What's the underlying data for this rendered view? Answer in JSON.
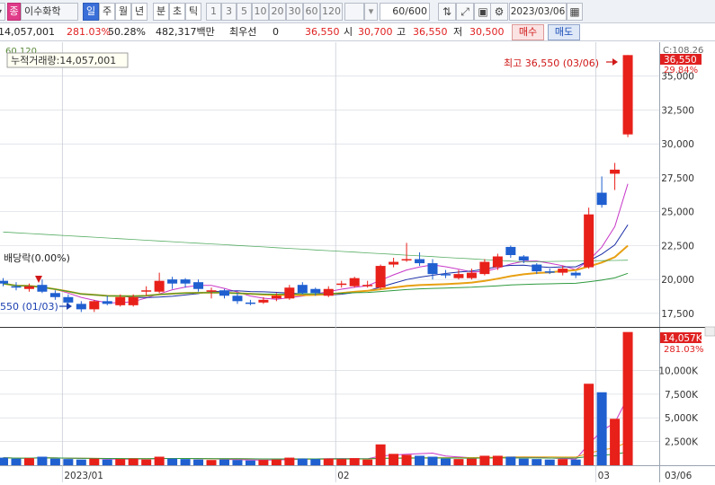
{
  "toolbar": {
    "stock_type_badge": "종",
    "stock_name": "이수화학",
    "period_tabs": [
      "일",
      "주",
      "월",
      "년",
      "분",
      "초",
      "틱"
    ],
    "selected_period": "일",
    "interval_buttons": [
      "1",
      "3",
      "5",
      "10",
      "20",
      "30",
      "60",
      "120"
    ],
    "count_value": "60",
    "count_total": "/600",
    "date_value": "2023/03/06"
  },
  "quote": {
    "volume": "14,057,001",
    "volume_ratio": "281.03%",
    "turnover_rate": "50.28%",
    "trade_value": "482,317백만",
    "priority_label": "최우선",
    "priority_value": "0",
    "current_price": "36,550",
    "open_label": "시",
    "open": "30,700",
    "high_label": "고",
    "high": "36,550",
    "low_label": "저",
    "low": "30,500",
    "buy_button": "매수",
    "sell_button": "매도"
  },
  "price_panel": {
    "ma_header": "60 120",
    "cum_volume_tooltip": "누적거래량:14,057,001",
    "high_annotation": "최고 36,550 (03/06)",
    "low_annotation": "550 (01/03)",
    "dividend_label": "배당락(0.00%)",
    "c_value": "C:108.26",
    "current_label": "36,550",
    "change_label": "29.84%"
  },
  "volume_panel": {
    "current_label": "14,057K",
    "ratio_label": "281.03%"
  },
  "chart_data": {
    "type": "candlestick",
    "price_axis": {
      "ticks": [
        17500,
        20000,
        22500,
        25000,
        27500,
        30000,
        32500,
        35000
      ],
      "ylim": [
        16500,
        37500
      ]
    },
    "volume_axis": {
      "ticks": [
        "2,500K",
        "5,000K",
        "7,500K",
        "10,000K"
      ],
      "tick_values": [
        2500,
        5000,
        7500,
        10000
      ],
      "ylim": [
        0,
        14500
      ]
    },
    "x_labels": [
      "2023/01",
      "02",
      "03",
      "03/06"
    ],
    "candles": [
      {
        "o": 19900,
        "c": 19700,
        "h": 20100,
        "l": 19500,
        "v": 800
      },
      {
        "o": 19500,
        "c": 19400,
        "h": 19800,
        "l": 19200,
        "v": 700
      },
      {
        "o": 19300,
        "c": 19500,
        "h": 19700,
        "l": 19100,
        "v": 750
      },
      {
        "o": 19600,
        "c": 19100,
        "h": 20000,
        "l": 19000,
        "v": 900
      },
      {
        "o": 19000,
        "c": 18700,
        "h": 19200,
        "l": 18500,
        "v": 700
      },
      {
        "o": 18700,
        "c": 18300,
        "h": 18900,
        "l": 18100,
        "v": 650
      },
      {
        "o": 18200,
        "c": 17800,
        "h": 18400,
        "l": 17600,
        "v": 600
      },
      {
        "o": 17800,
        "c": 18400,
        "h": 18500,
        "l": 17600,
        "v": 700
      },
      {
        "o": 18400,
        "c": 18200,
        "h": 18800,
        "l": 18100,
        "v": 600
      },
      {
        "o": 18100,
        "c": 18700,
        "h": 18900,
        "l": 18000,
        "v": 650
      },
      {
        "o": 18100,
        "c": 18700,
        "h": 18900,
        "l": 18000,
        "v": 700
      },
      {
        "o": 19100,
        "c": 19200,
        "h": 19500,
        "l": 18800,
        "v": 600
      },
      {
        "o": 19100,
        "c": 19900,
        "h": 20500,
        "l": 19000,
        "v": 900
      },
      {
        "o": 20000,
        "c": 19700,
        "h": 20200,
        "l": 19300,
        "v": 700
      },
      {
        "o": 20000,
        "c": 19700,
        "h": 20100,
        "l": 19400,
        "v": 650
      },
      {
        "o": 19800,
        "c": 19300,
        "h": 20000,
        "l": 19100,
        "v": 600
      },
      {
        "o": 19100,
        "c": 19200,
        "h": 19400,
        "l": 18600,
        "v": 550
      },
      {
        "o": 19200,
        "c": 18800,
        "h": 19300,
        "l": 18600,
        "v": 600
      },
      {
        "o": 18800,
        "c": 18400,
        "h": 19000,
        "l": 18200,
        "v": 550
      },
      {
        "o": 18300,
        "c": 18200,
        "h": 18500,
        "l": 18100,
        "v": 500
      },
      {
        "o": 18300,
        "c": 18500,
        "h": 18700,
        "l": 18200,
        "v": 550
      },
      {
        "o": 18600,
        "c": 18800,
        "h": 19000,
        "l": 18400,
        "v": 600
      },
      {
        "o": 18600,
        "c": 19400,
        "h": 19600,
        "l": 18500,
        "v": 800
      },
      {
        "o": 19600,
        "c": 19000,
        "h": 19800,
        "l": 18900,
        "v": 700
      },
      {
        "o": 19300,
        "c": 19000,
        "h": 19400,
        "l": 18800,
        "v": 650
      },
      {
        "o": 18800,
        "c": 19300,
        "h": 19500,
        "l": 18700,
        "v": 700
      },
      {
        "o": 19600,
        "c": 19700,
        "h": 19900,
        "l": 19400,
        "v": 650
      },
      {
        "o": 19500,
        "c": 20100,
        "h": 20200,
        "l": 19400,
        "v": 750
      },
      {
        "o": 19600,
        "c": 19600,
        "h": 19900,
        "l": 19400,
        "v": 600
      },
      {
        "o": 19400,
        "c": 21000,
        "h": 21100,
        "l": 19300,
        "v": 2200
      },
      {
        "o": 21100,
        "c": 21300,
        "h": 21600,
        "l": 20900,
        "v": 1200
      },
      {
        "o": 21500,
        "c": 21500,
        "h": 22700,
        "l": 21300,
        "v": 1100
      },
      {
        "o": 21500,
        "c": 21200,
        "h": 22000,
        "l": 21000,
        "v": 1000
      },
      {
        "o": 21200,
        "c": 20400,
        "h": 21500,
        "l": 20000,
        "v": 900
      },
      {
        "o": 20400,
        "c": 20300,
        "h": 20700,
        "l": 20100,
        "v": 700
      },
      {
        "o": 20100,
        "c": 20400,
        "h": 20700,
        "l": 20000,
        "v": 650
      },
      {
        "o": 20100,
        "c": 20500,
        "h": 20800,
        "l": 20000,
        "v": 700
      },
      {
        "o": 20400,
        "c": 21300,
        "h": 21500,
        "l": 20300,
        "v": 1000
      },
      {
        "o": 20900,
        "c": 21700,
        "h": 21900,
        "l": 20700,
        "v": 1000
      },
      {
        "o": 22400,
        "c": 21800,
        "h": 22500,
        "l": 21600,
        "v": 900
      },
      {
        "o": 21700,
        "c": 21400,
        "h": 21800,
        "l": 21200,
        "v": 700
      },
      {
        "o": 21100,
        "c": 20600,
        "h": 21200,
        "l": 20400,
        "v": 650
      },
      {
        "o": 20600,
        "c": 20500,
        "h": 20800,
        "l": 20400,
        "v": 600
      },
      {
        "o": 20500,
        "c": 20800,
        "h": 21000,
        "l": 20300,
        "v": 650
      },
      {
        "o": 20500,
        "c": 20300,
        "h": 20600,
        "l": 20100,
        "v": 600
      },
      {
        "o": 20900,
        "c": 24800,
        "h": 25300,
        "l": 20800,
        "v": 8600
      },
      {
        "o": 26400,
        "c": 25500,
        "h": 27600,
        "l": 25300,
        "v": 7700
      },
      {
        "o": 27800,
        "c": 28100,
        "h": 28600,
        "l": 26600,
        "v": 4900
      },
      {
        "o": 30700,
        "c": 36550,
        "h": 36550,
        "l": 30500,
        "v": 14057
      }
    ]
  }
}
